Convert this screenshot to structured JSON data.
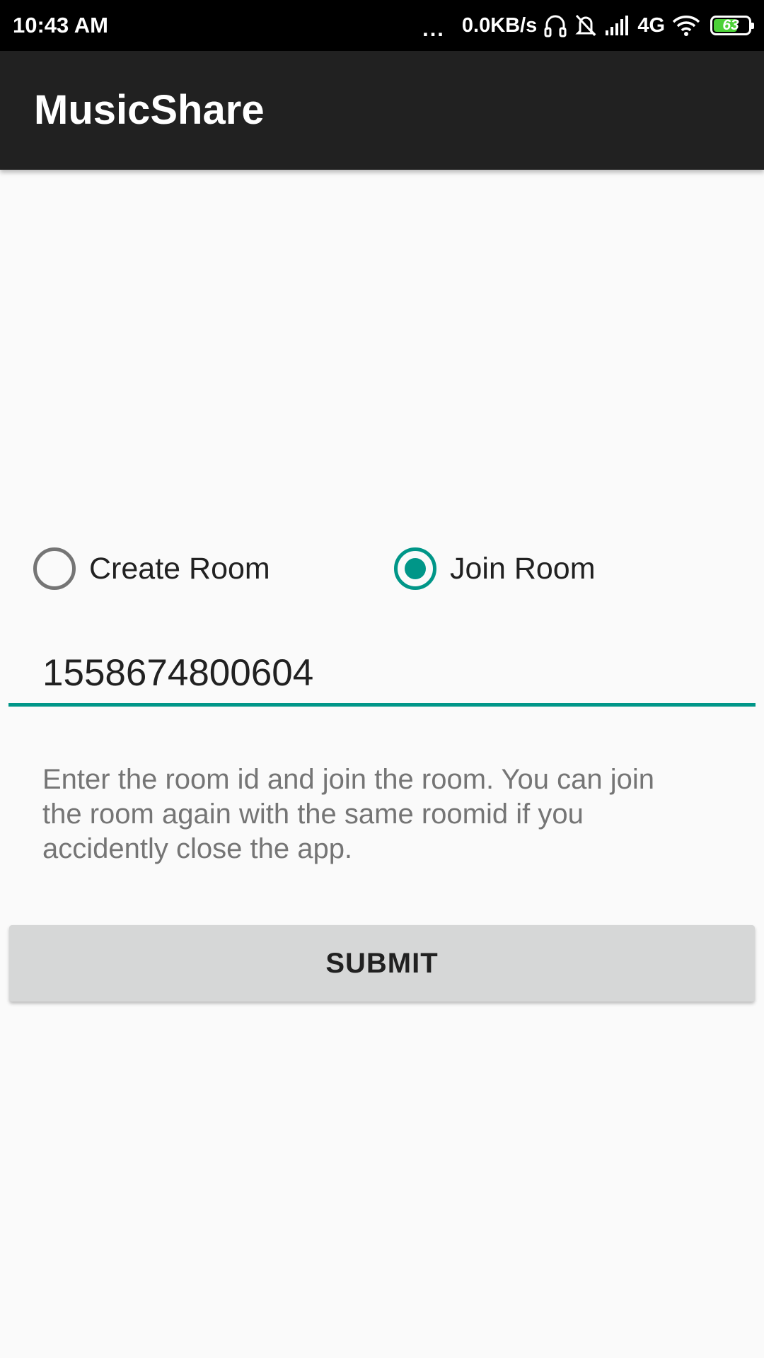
{
  "status_bar": {
    "time": "10:43 AM",
    "dots": "...",
    "speed": "0.0KB/s",
    "network": "4G",
    "battery_level": "63",
    "battery_fill_color": "#4cd137",
    "icons": [
      "headset-icon",
      "mute-icon",
      "signal-icon",
      "wifi-icon",
      "battery-icon"
    ]
  },
  "app_bar": {
    "title": "MusicShare",
    "background": "#212121"
  },
  "room_mode": {
    "options": [
      {
        "label": "Create Room",
        "checked": false
      },
      {
        "label": "Join Room",
        "checked": true
      }
    ],
    "accent": "#009688"
  },
  "room_id_input": {
    "value": "1558674800604"
  },
  "help_text": "Enter the room id and join the room. You can join the room again with the same roomid if you accidently close the app.",
  "submit_button": {
    "label": "SUBMIT"
  }
}
